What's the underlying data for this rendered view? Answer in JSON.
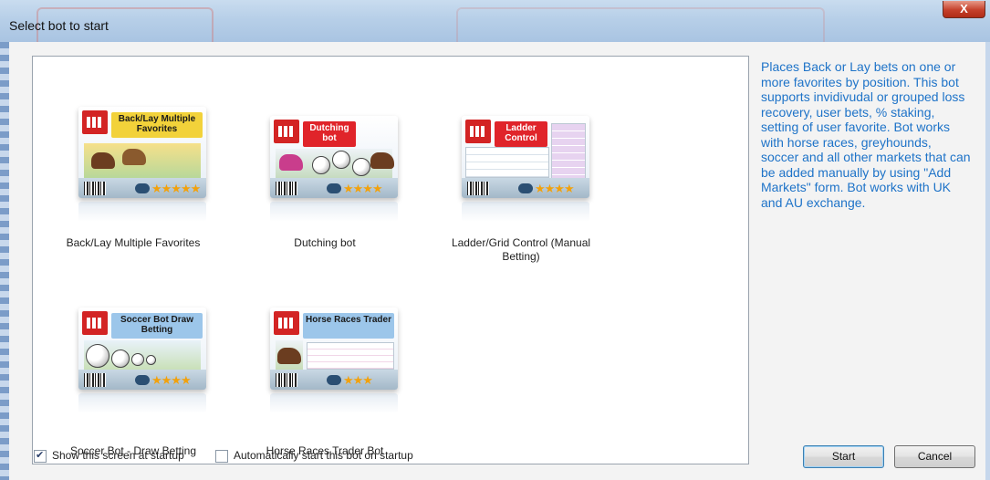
{
  "window": {
    "title": "Select bot to start",
    "close_label": "X"
  },
  "bots": [
    {
      "name": "Back/Lay Multiple Favorites",
      "card_title": "Back/Lay Multiple Favorites",
      "card_color": "#f2d23a",
      "stars": "★★★★★"
    },
    {
      "name": "Dutching bot",
      "card_title": "Dutching bot",
      "card_color": "#e0242a",
      "stars": "★★★★"
    },
    {
      "name": "Ladder/Grid Control (Manual Betting)",
      "card_title": "Ladder Control",
      "card_color": "#e0242a",
      "stars": "★★★★"
    },
    {
      "name": "Soccer Bot - Draw Betting",
      "card_title": "Soccer Bot Draw Betting",
      "card_color": "#9cc6ea",
      "stars": "★★★★"
    },
    {
      "name": "Horse Races Trader Bot",
      "card_title": "Horse Races Trader",
      "card_color": "#9cc6ea",
      "stars": "★★★"
    }
  ],
  "description": "Places Back or Lay bets on one or more favorites by position. This bot supports invidivudal or grouped loss recovery, user bets, % staking, setting of user favorite. Bot works with horse races, greyhounds, soccer and all other markets that can be added manually by using \"Add Markets\" form. Bot works with UK and AU exchange.",
  "footer": {
    "show_at_startup": {
      "label": "Show this screen at startup",
      "checked": true
    },
    "auto_start": {
      "label": "Automatically start this bot on startup",
      "checked": false
    },
    "start_label": "Start",
    "cancel_label": "Cancel"
  }
}
